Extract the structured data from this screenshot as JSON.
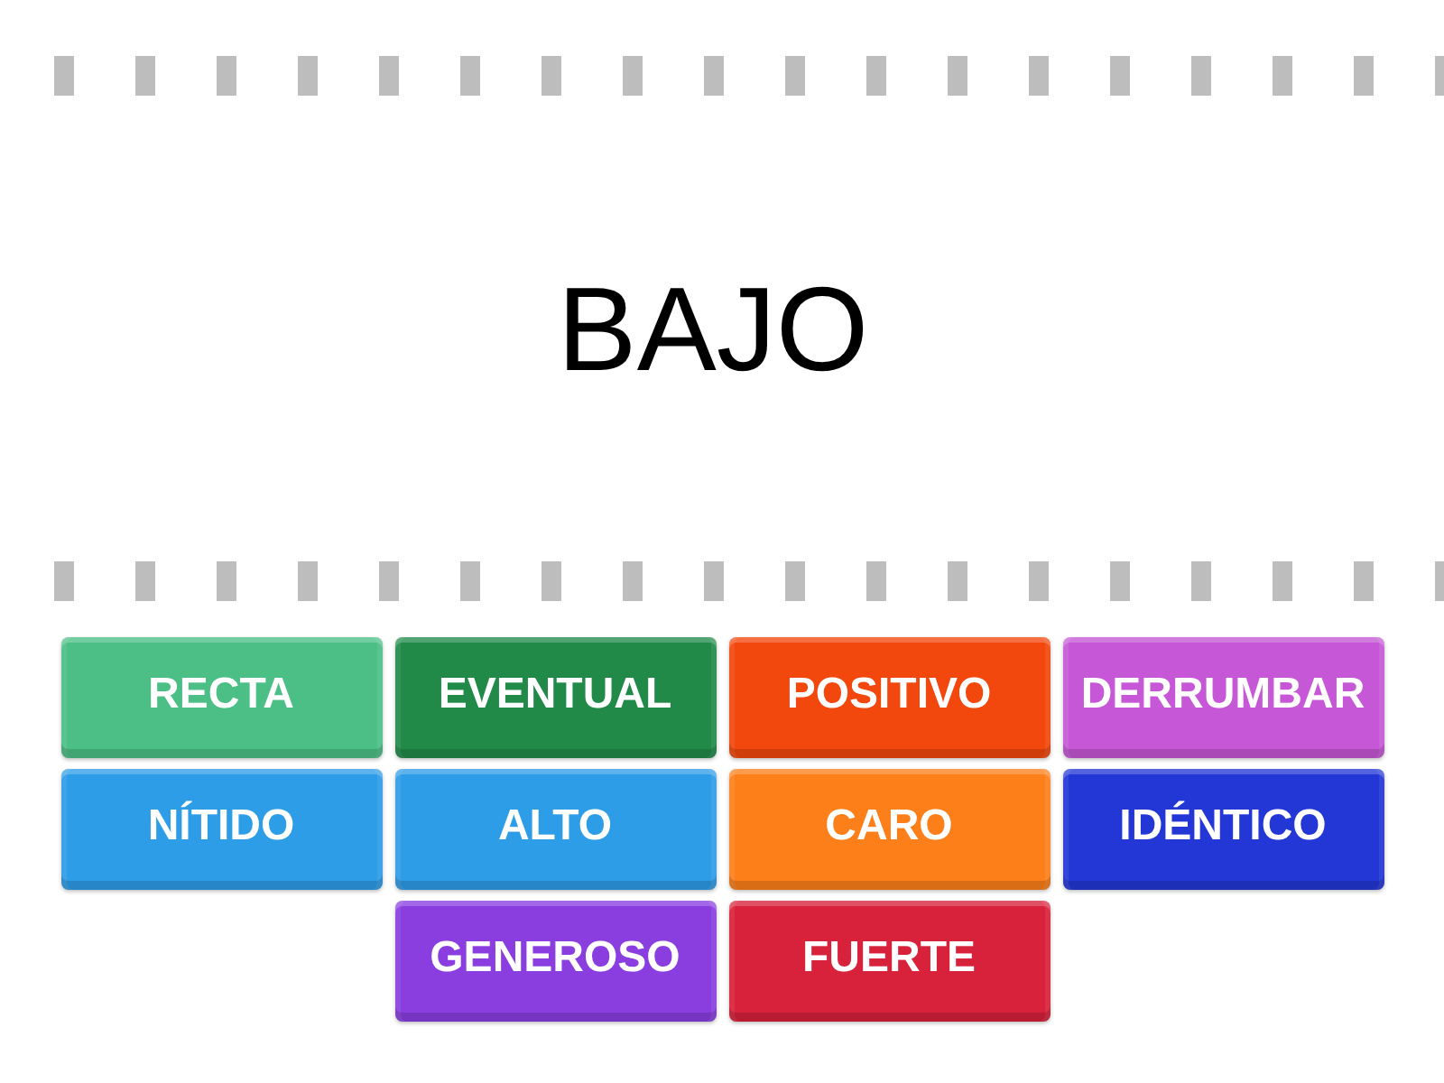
{
  "prompt": "BAJO",
  "tiles": [
    {
      "label": "RECTA",
      "color": "#4bbf86"
    },
    {
      "label": "EVENTUAL",
      "color": "#218a49"
    },
    {
      "label": "POSITIVO",
      "color": "#f2470d"
    },
    {
      "label": "DERRUMBAR",
      "color": "#c657d6"
    },
    {
      "label": "NÍTIDO",
      "color": "#2e9de8"
    },
    {
      "label": "ALTO",
      "color": "#2e9de8"
    },
    {
      "label": "CARO",
      "color": "#fc7f1a"
    },
    {
      "label": "IDÉNTICO",
      "color": "#2337d6"
    },
    {
      "label": "GENEROSO",
      "color": "#8a3ee0"
    },
    {
      "label": "FUERTE",
      "color": "#d8213b"
    }
  ]
}
